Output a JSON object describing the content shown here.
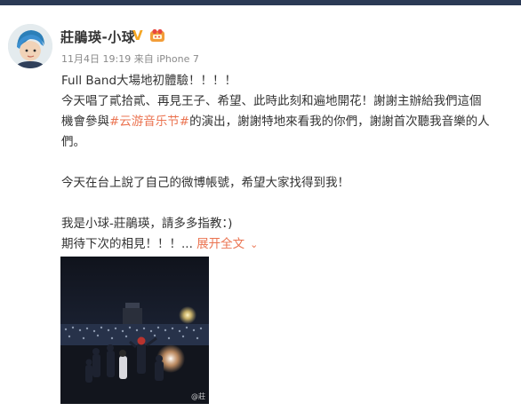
{
  "author": {
    "name": "莊鵑瑛-小球",
    "verified_mark": "V"
  },
  "meta": {
    "date": "11月4日",
    "time": "19:19",
    "source_prefix": "来自",
    "source": "iPhone 7"
  },
  "post": {
    "line1": "Full Band大場地初體驗！！！！",
    "line2": "今天唱了貳拾貳、再見王子、希望、此時此刻和遍地開花！謝謝主辦給我們這個",
    "line3_before": "機會參與",
    "topic": "#云游音乐节#",
    "line3_after": "的演出，謝謝特地來看我的你們，謝謝首次聽我音樂的人",
    "line4": "們。",
    "line5": "今天在台上說了自己的微博帳號，希望大家找得到我！",
    "line6": "我是小球-莊鵑瑛，請多多指教：)",
    "line7": "期待下次的相見！！！...",
    "expand": "展开全文",
    "expand_icon": "chevron-down-icon"
  },
  "photo": {
    "watermark": "@莊"
  },
  "colors": {
    "accent": "#eb7350",
    "verified": "#f5a623",
    "text": "#333333",
    "meta": "#8a8a8a"
  }
}
